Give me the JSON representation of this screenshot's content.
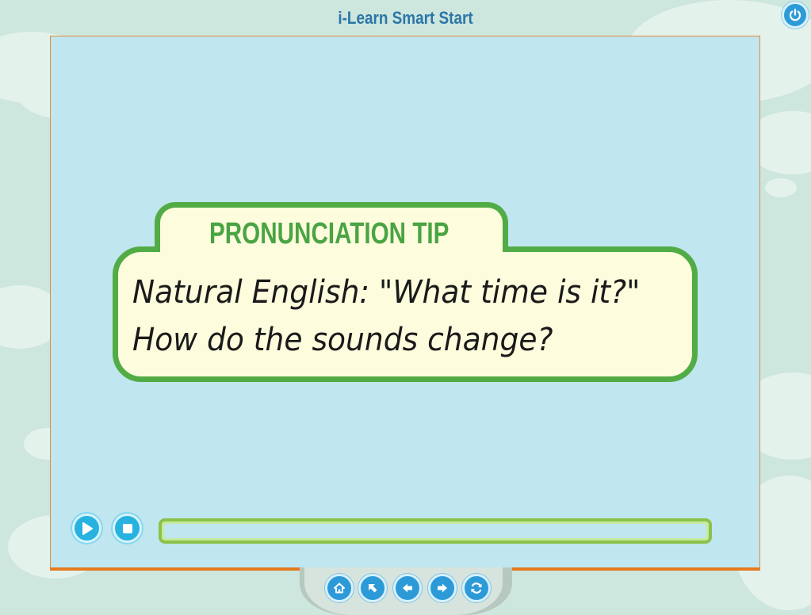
{
  "app": {
    "title": "i-Learn Smart Start"
  },
  "tip": {
    "heading": "PRONUNCIATION TIP",
    "line1": "Natural English: \"What time is it?\"",
    "line2": "How do the sounds change?"
  },
  "player": {
    "progress": 0.0
  },
  "icons": {
    "power": "power-icon",
    "play": "play-icon",
    "stop": "stop-icon",
    "home": "home-icon",
    "back_up": "arrow-up-left-icon",
    "previous": "arrow-left-icon",
    "next": "arrow-right-icon",
    "refresh": "refresh-icon"
  },
  "colors": {
    "frame_bg": "#c0e6ef",
    "frame_border": "#e67a1f",
    "card_border": "#52ac46",
    "card_bg": "#fdfcdd",
    "heading": "#4aa443",
    "button_blue": "#27b2e0",
    "progress_border": "#8cc24a",
    "title": "#2b76a6"
  }
}
